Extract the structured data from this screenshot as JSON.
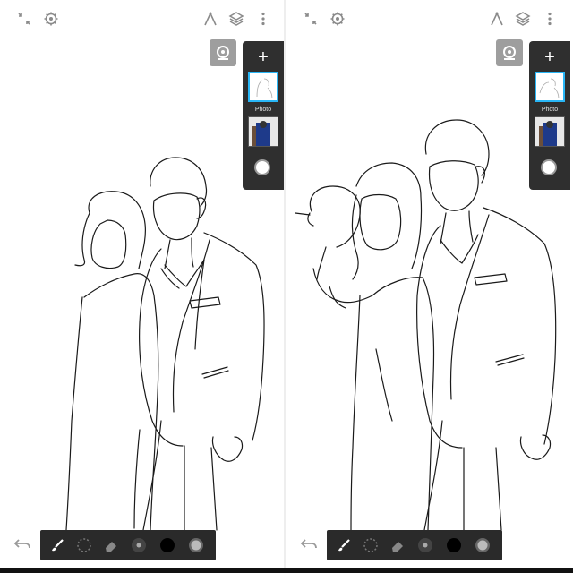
{
  "layers": {
    "add_label": "+",
    "active_layer_name": "Photo"
  },
  "icons": {
    "collapse": "collapse-icon",
    "settings": "gear-icon",
    "ruler": "ruler-icon",
    "layers": "layers-icon",
    "more": "more-vertical-icon",
    "reference": "reference-image-icon",
    "undo": "undo-icon",
    "brush": "brush-icon",
    "lasso": "lasso-select-icon",
    "eraser": "eraser-icon",
    "brush_size": "brush-size-icon",
    "color": "color-swatch-icon",
    "opacity": "opacity-icon"
  },
  "colors": {
    "toolbar": "#2a2a2a",
    "panel": "#2f2f2f",
    "active_layer_border": "#29b6f6",
    "icon_gray": "#8a8a8a",
    "selected_color": "#000000"
  }
}
